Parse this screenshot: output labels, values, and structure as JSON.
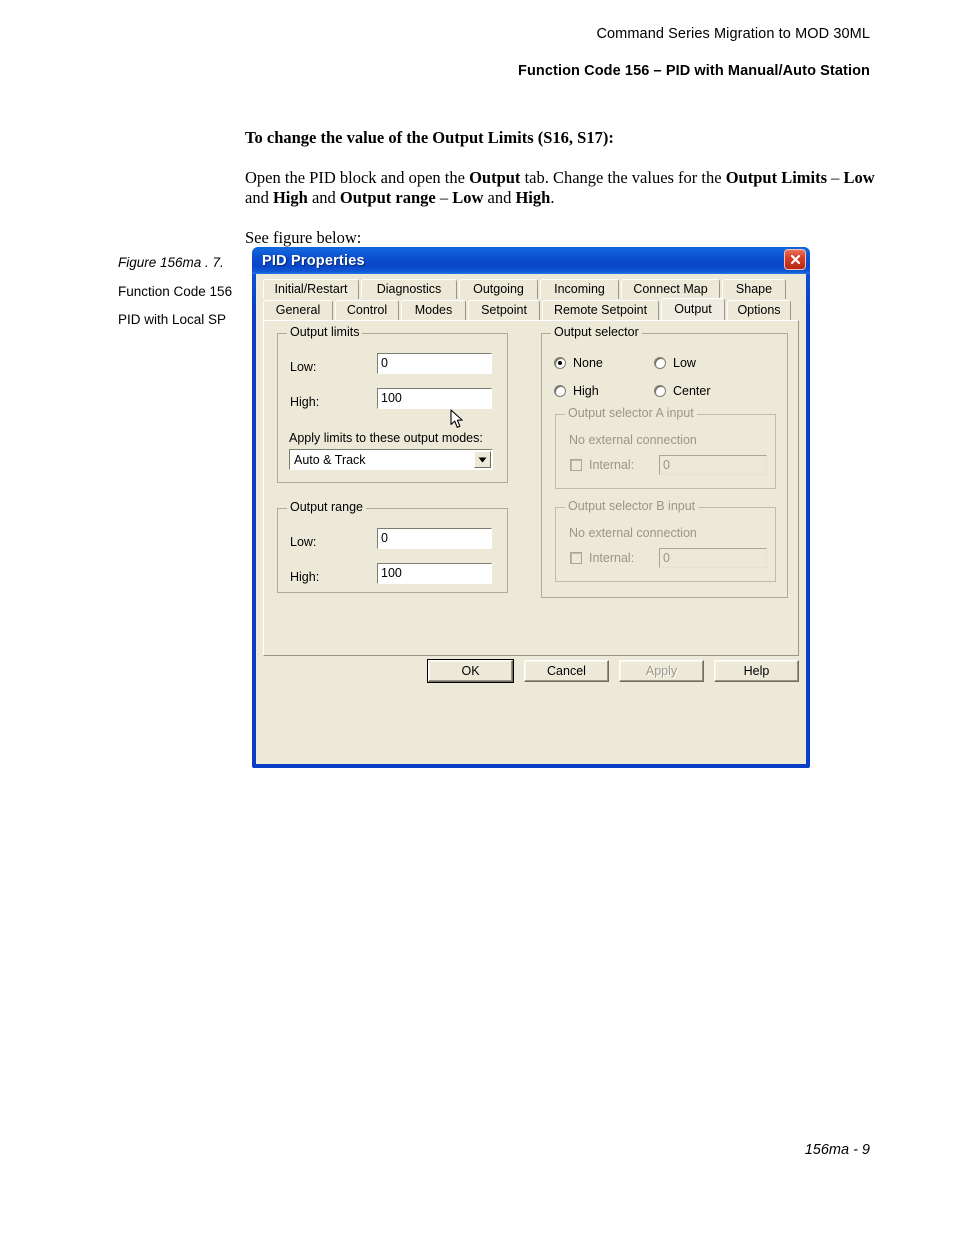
{
  "page": {
    "header_line1": "Command Series Migration to MOD 30ML",
    "header_line2": "Function Code 156 – PID with Manual/Auto Station",
    "footer": "156ma - 9"
  },
  "content": {
    "heading": "To change the value of the Output Limits (S16, S17):",
    "paragraph": {
      "p1": "Open the PID block and open the ",
      "b1": "Output",
      "p2": " tab. Change the values for the ",
      "b2": "Output Limits",
      "p3": " – ",
      "b3": "Low",
      "p4": " and ",
      "b4": "High",
      "p5": " and ",
      "b5": "Output range",
      "p6": " – ",
      "b6": "Low",
      "p7": " and ",
      "b7": "High",
      "p8": "."
    },
    "see_figure": "See figure below:"
  },
  "caption": {
    "title": "Figure 156ma . 7.",
    "line2": "Function Code 156",
    "line3": "PID with Local SP"
  },
  "dialog": {
    "title": "PID Properties",
    "close_icon": "close-icon",
    "tabs_row1": [
      {
        "label": "Initial/Restart",
        "active": false
      },
      {
        "label": "Diagnostics",
        "active": false
      },
      {
        "label": "Outgoing",
        "active": false
      },
      {
        "label": "Incoming",
        "active": false
      },
      {
        "label": "Connect Map",
        "active": false
      },
      {
        "label": "Shape",
        "active": false
      }
    ],
    "tabs_row2": [
      {
        "label": "General",
        "active": false
      },
      {
        "label": "Control",
        "active": false
      },
      {
        "label": "Modes",
        "active": false
      },
      {
        "label": "Setpoint",
        "active": false
      },
      {
        "label": "Remote Setpoint",
        "active": false
      },
      {
        "label": "Output",
        "active": true
      },
      {
        "label": "Options",
        "active": false
      }
    ],
    "output_limits": {
      "title": "Output limits",
      "low_label": "Low:",
      "low_value": "0",
      "high_label": "High:",
      "high_value": "100",
      "apply_label": "Apply limits to these output modes:",
      "apply_mode_value": "Auto & Track"
    },
    "output_range": {
      "title": "Output range",
      "low_label": "Low:",
      "low_value": "0",
      "high_label": "High:",
      "high_value": "100"
    },
    "output_selector": {
      "title": "Output selector",
      "options": [
        {
          "label": "None",
          "selected": true
        },
        {
          "label": "Low",
          "selected": false
        },
        {
          "label": "High",
          "selected": false
        },
        {
          "label": "Center",
          "selected": false
        }
      ]
    },
    "selector_a": {
      "title": "Output selector A input",
      "connection_text": "No external connection",
      "internal_label": "Internal:",
      "internal_checked": false,
      "internal_value": "0"
    },
    "selector_b": {
      "title": "Output selector B input",
      "connection_text": "No external connection",
      "internal_label": "Internal:",
      "internal_checked": false,
      "internal_value": "0"
    },
    "buttons": {
      "ok": "OK",
      "cancel": "Cancel",
      "apply": "Apply",
      "help": "Help"
    }
  },
  "colors": {
    "titlebar_blue": "#0a46c9",
    "dialog_face": "#ece9d8",
    "close_red": "#d8412a",
    "disabled_text": "#9a978a"
  }
}
